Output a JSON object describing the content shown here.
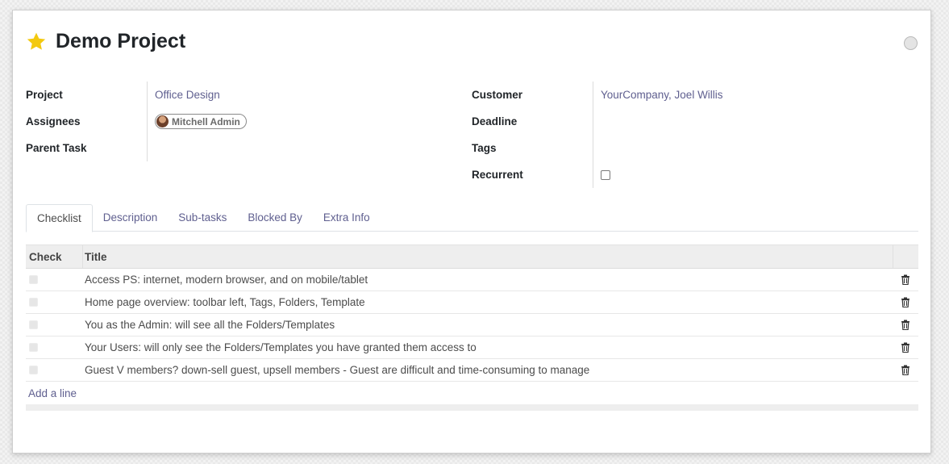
{
  "task": {
    "title": "Demo Project",
    "favorite": true
  },
  "fields_left": [
    {
      "label": "Project",
      "value": "Office Design"
    },
    {
      "label": "Assignees",
      "value": "Mitchell Admin"
    },
    {
      "label": "Parent Task",
      "value": ""
    }
  ],
  "fields_right": [
    {
      "label": "Customer",
      "value": "YourCompany, Joel Willis"
    },
    {
      "label": "Deadline",
      "value": ""
    },
    {
      "label": "Tags",
      "value": ""
    },
    {
      "label": "Recurrent",
      "value": ""
    }
  ],
  "tabs": [
    {
      "label": "Checklist",
      "active": true
    },
    {
      "label": "Description"
    },
    {
      "label": "Sub-tasks"
    },
    {
      "label": "Blocked By"
    },
    {
      "label": "Extra Info"
    }
  ],
  "checklist": {
    "headers": {
      "check": "Check",
      "title": "Title"
    },
    "rows": [
      {
        "title": "Access PS: internet, modern browser, and on mobile/tablet"
      },
      {
        "title": "Home page overview: toolbar left, Tags, Folders, Template"
      },
      {
        "title": "You as the Admin: will see all the Folders/Templates"
      },
      {
        "title": "Your Users: will only see the Folders/Templates you have granted them access to"
      },
      {
        "title": "Guest V members? down-sell guest, upsell members - Guest are difficult and time-consuming to manage"
      }
    ],
    "add_line": "Add a line"
  },
  "colors": {
    "star": "#f3c90f",
    "link": "#5f5f8f"
  }
}
